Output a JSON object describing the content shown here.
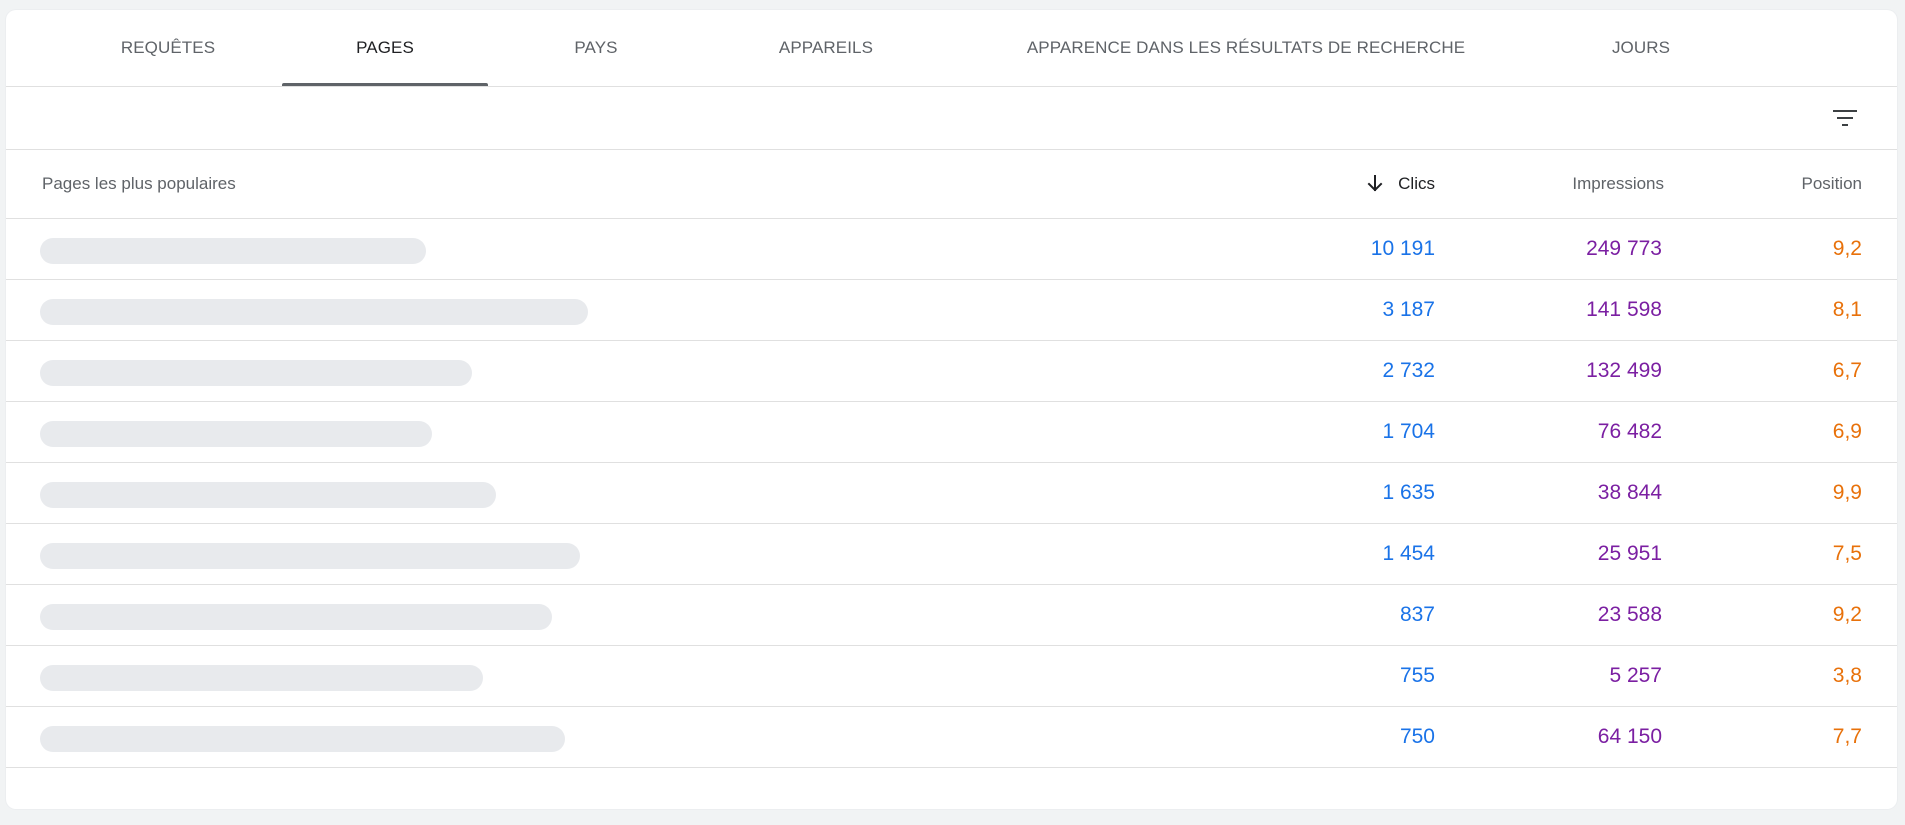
{
  "tabs": [
    {
      "label": "REQUÊTES"
    },
    {
      "label": "PAGES"
    },
    {
      "label": "PAYS"
    },
    {
      "label": "APPAREILS"
    },
    {
      "label": "APPARENCE DANS LES RÉSULTATS DE RECHERCHE"
    },
    {
      "label": "JOURS"
    }
  ],
  "active_tab": "PAGES",
  "table": {
    "headers": {
      "page": "Pages les plus populaires",
      "clicks": "Clics",
      "impressions": "Impressions",
      "position": "Position"
    },
    "sort": {
      "column": "clicks",
      "direction": "descending",
      "icon": "arrow-down-icon"
    },
    "rows": [
      {
        "clicks": "10 191",
        "impressions": "249 773",
        "position": "9,2"
      },
      {
        "clicks": "3 187",
        "impressions": "141 598",
        "position": "8,1"
      },
      {
        "clicks": "2 732",
        "impressions": "132 499",
        "position": "6,7"
      },
      {
        "clicks": "1 704",
        "impressions": "76 482",
        "position": "6,9"
      },
      {
        "clicks": "1 635",
        "impressions": "38 844",
        "position": "9,9"
      },
      {
        "clicks": "1 454",
        "impressions": "25 951",
        "position": "7,5"
      },
      {
        "clicks": "837",
        "impressions": "23 588",
        "position": "9,2"
      },
      {
        "clicks": "755",
        "impressions": "5 257",
        "position": "3,8"
      },
      {
        "clicks": "750",
        "impressions": "64 150",
        "position": "7,7"
      }
    ]
  },
  "toolbar": {
    "filter_icon": "filter-icon"
  },
  "colors": {
    "clicks": "#1a73e8",
    "impressions": "#7b1fa2",
    "position": "#e8710a",
    "page_placeholder": "#e8eaed"
  }
}
